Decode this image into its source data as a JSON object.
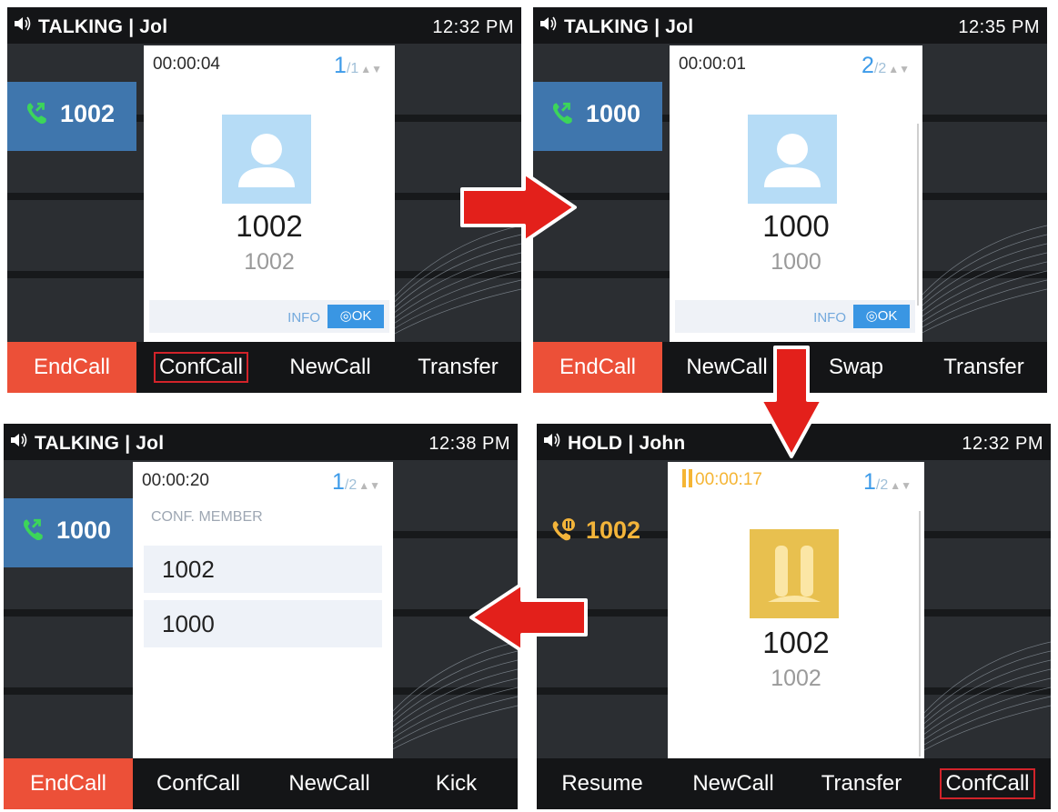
{
  "screens": [
    {
      "status": {
        "left": "TALKING | Jol",
        "time": "12:32 PM"
      },
      "line": {
        "number": "1002",
        "state": "talking"
      },
      "card": {
        "timer": "00:00:04",
        "page_current": "1",
        "page_total": "/1",
        "name": "1002",
        "number": "1002",
        "info": "INFO",
        "ok": "OK"
      },
      "softkeys": [
        "EndCall",
        "ConfCall",
        "NewCall",
        "Transfer"
      ],
      "highlighted_softkey": "ConfCall"
    },
    {
      "status": {
        "left": "TALKING | Jol",
        "time": "12:35 PM"
      },
      "line": {
        "number": "1000",
        "state": "talking"
      },
      "card": {
        "timer": "00:00:01",
        "page_current": "2",
        "page_total": "/2",
        "name": "1000",
        "number": "1000",
        "info": "INFO",
        "ok": "OK"
      },
      "softkeys": [
        "EndCall",
        "NewCall",
        "Swap",
        "Transfer"
      ]
    },
    {
      "status": {
        "left": "TALKING | Jol",
        "time": "12:38 PM"
      },
      "line": {
        "number": "1000",
        "state": "talking"
      },
      "card": {
        "timer": "00:00:20",
        "page_current": "1",
        "page_total": "/2",
        "conf_label": "CONF. MEMBER",
        "members": [
          "1002",
          "1000"
        ]
      },
      "softkeys": [
        "EndCall",
        "ConfCall",
        "NewCall",
        "Kick"
      ]
    },
    {
      "status": {
        "left": "HOLD | John",
        "time": "12:32 PM"
      },
      "line": {
        "number": "1002",
        "state": "hold"
      },
      "card": {
        "timer": "00:00:17",
        "page_current": "1",
        "page_total": "/2",
        "name": "1002",
        "number": "1002"
      },
      "softkeys": [
        "Resume",
        "NewCall",
        "Transfer",
        "ConfCall"
      ],
      "highlighted_softkey": "ConfCall"
    }
  ],
  "colors": {
    "endcall": "#ec5038",
    "active_line": "#3f76ad",
    "hold": "#f3b43a",
    "arrow": "#e3201b",
    "accent": "#3d9be9"
  },
  "icons": {
    "speaker": "speaker-icon",
    "call": "phone-active-icon",
    "hold": "phone-hold-icon",
    "avatar": "person-icon",
    "hold_avatar": "pause-icon",
    "ok": "ok-target-icon"
  }
}
